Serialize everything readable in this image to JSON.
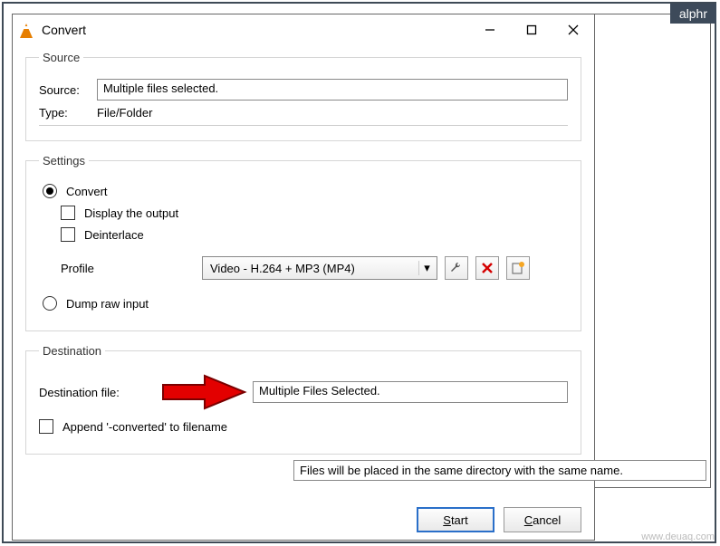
{
  "brand": {
    "badge": "alphr",
    "watermark": "www.deuaq.com"
  },
  "titlebar": {
    "title": "Convert",
    "app_icon": "vlc-cone-icon"
  },
  "source": {
    "legend": "Source",
    "source_label": "Source:",
    "source_value": "Multiple files selected.",
    "type_label": "Type:",
    "type_value": "File/Folder"
  },
  "settings": {
    "legend": "Settings",
    "convert_label": "Convert",
    "display_output_label": "Display the output",
    "deinterlace_label": "Deinterlace",
    "profile_label": "Profile",
    "profile_value": "Video - H.264 + MP3 (MP4)",
    "tool_edit": "wrench-icon",
    "tool_delete": "delete-icon",
    "tool_new": "new-profile-icon",
    "dump_label": "Dump raw input"
  },
  "destination": {
    "legend": "Destination",
    "file_label": "Destination file:",
    "file_value": "Multiple Files Selected.",
    "append_label": "Append '-converted' to filename",
    "tooltip": "Files will be placed in the same directory with the same name."
  },
  "footer": {
    "start": "Start",
    "cancel": "Cancel"
  }
}
